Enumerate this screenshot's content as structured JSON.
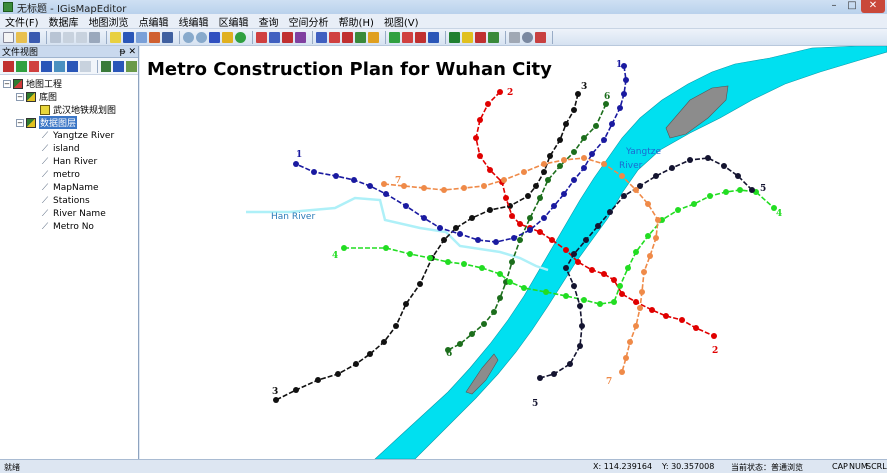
{
  "window": {
    "title": "无标题 - IGisMapEditor",
    "minimize": "–",
    "maximize": "□",
    "close": "✕"
  },
  "menu": [
    "文件(F)",
    "数据库",
    "地图浏览",
    "点编辑",
    "线编辑",
    "区编辑",
    "查询",
    "空间分析",
    "帮助(H)",
    "视图(V)"
  ],
  "panel": {
    "title": "文件视图",
    "pin": "ᵽ",
    "close": "✕",
    "tree": {
      "root": "地图工程",
      "base_group": "底图",
      "base_item": "武汉地铁规划图",
      "data_group": "数据图层",
      "layers": [
        "Yangtze River",
        "island",
        "Han River",
        "metro",
        "MapName",
        "Stations",
        "River Name",
        "Metro No"
      ]
    }
  },
  "map": {
    "title": "Metro Construction Plan for Wuhan City",
    "labels": {
      "yangtze1": "Yangtze",
      "yangtze2": "River",
      "han": "Han River"
    },
    "line_numbers": {
      "l1a": "1",
      "l1b": "1",
      "l2a": "2",
      "l2b": "2",
      "l3a": "3",
      "l3b": "3",
      "l4a": "4",
      "l4b": "4",
      "l5a": "5",
      "l5b": "5",
      "l6a": "6",
      "l6b": "6",
      "l7a": "7",
      "l7b": "7"
    },
    "colors": {
      "line1": "#1a1aa0",
      "line2": "#e00000",
      "line3": "#111111",
      "line4": "#22dd22",
      "line5": "#141430",
      "line6": "#1c6e1c",
      "line7": "#ef8a48",
      "water": "#00e0f0",
      "island": "#8c8c8c"
    }
  },
  "status": {
    "ready": "就绪",
    "x": "X: 114.239164",
    "y": "Y: 30.357008",
    "state": "当前状态：普通浏览",
    "caps": "CAP",
    "num": "NUM",
    "scrl": "SCRL"
  }
}
